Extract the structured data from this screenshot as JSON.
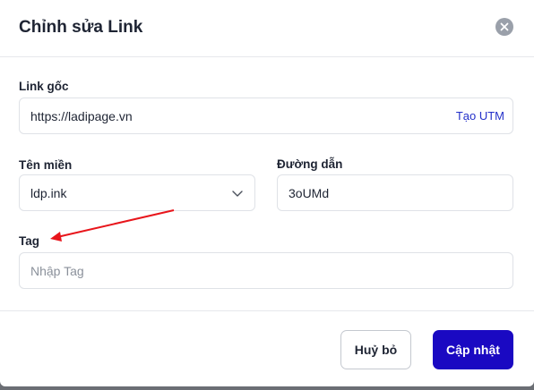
{
  "modal": {
    "title": "Chỉnh sửa Link",
    "close_icon": "close-icon"
  },
  "fields": {
    "original_link": {
      "label": "Link gốc",
      "value": "https://ladipage.vn",
      "utm_label": "Tạo UTM"
    },
    "domain": {
      "label": "Tên miền",
      "value": "ldp.ink"
    },
    "path": {
      "label": "Đường dẫn",
      "value": "3oUMd"
    },
    "tag": {
      "label": "Tag",
      "placeholder": "Nhập Tag"
    }
  },
  "footer": {
    "cancel_label": "Huỷ bỏ",
    "update_label": "Cập nhật"
  },
  "colors": {
    "accent": "#1a09c2",
    "link": "#2330c9",
    "annotation_arrow": "#e8151b"
  }
}
